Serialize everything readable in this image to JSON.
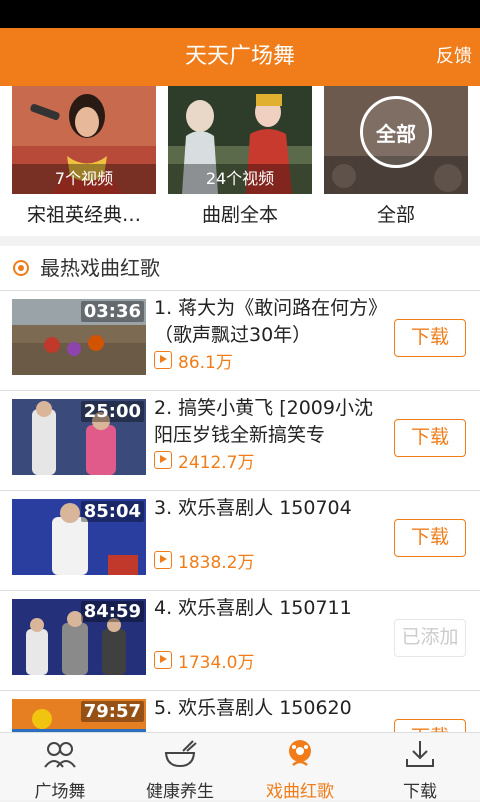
{
  "header": {
    "title": "天天广场舞",
    "feedback": "反馈"
  },
  "featured": [
    {
      "count": "7个视频",
      "label": "宋祖英经典…"
    },
    {
      "count": "24个视频",
      "label": "曲剧全本"
    },
    {
      "badge": "全部",
      "label": "全部"
    }
  ],
  "section": {
    "title": "最热戏曲红歌"
  },
  "videos": [
    {
      "duration": "03:36",
      "title": "1. 蒋大为《敢问路在何方》（歌声飘过30年）",
      "views": "86.1万",
      "action": "下载"
    },
    {
      "duration": "25:00",
      "title": "2. 搞笑小黄飞 [2009小沈阳压岁钱全新搞笑专",
      "views": "2412.7万",
      "action": "下载"
    },
    {
      "duration": "85:04",
      "title": "3. 欢乐喜剧人 150704",
      "views": "1838.2万",
      "action": "下载"
    },
    {
      "duration": "84:59",
      "title": "4. 欢乐喜剧人 150711",
      "views": "1734.0万",
      "action": "已添加"
    },
    {
      "duration": "79:57",
      "title": "5. 欢乐喜剧人 150620",
      "views": "",
      "action": "下载"
    }
  ],
  "tabs": [
    {
      "label": "广场舞",
      "icon": "people-icon"
    },
    {
      "label": "健康养生",
      "icon": "bowl-icon"
    },
    {
      "label": "戏曲红歌",
      "icon": "flower-icon"
    },
    {
      "label": "下载",
      "icon": "download-icon"
    }
  ],
  "colors": {
    "accent": "#f07d1a",
    "statusbar": "#000000"
  }
}
